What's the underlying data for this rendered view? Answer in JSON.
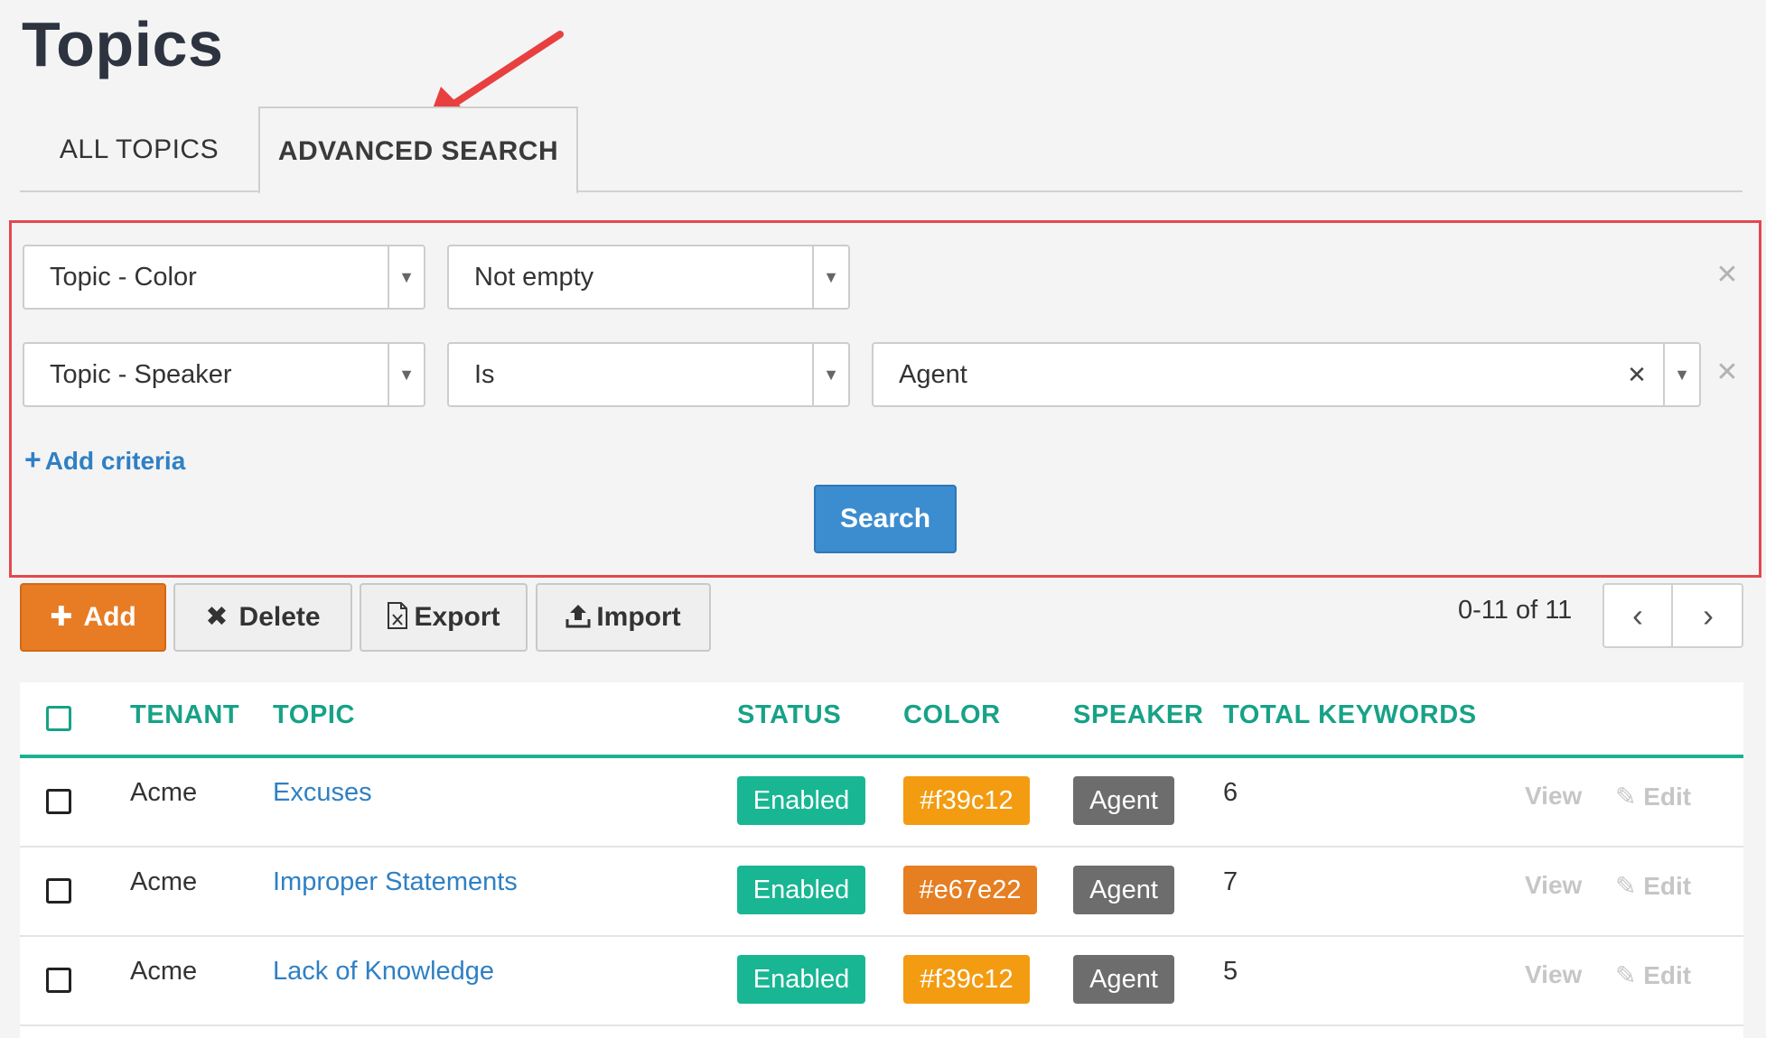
{
  "page": {
    "title": "Topics"
  },
  "tabs": [
    {
      "label": "ALL TOPICS",
      "active": false
    },
    {
      "label": "ADVANCED SEARCH",
      "active": true
    }
  ],
  "criteria": [
    {
      "field": "Topic - Color",
      "operator": "Not empty",
      "value": ""
    },
    {
      "field": "Topic - Speaker",
      "operator": "Is",
      "value": "Agent"
    }
  ],
  "actions": {
    "add_criteria": "Add criteria",
    "search": "Search",
    "add": "Add",
    "delete": "Delete",
    "export": "Export",
    "import": "Import"
  },
  "pagination": {
    "text": "0-11 of 11"
  },
  "table": {
    "columns": [
      "TENANT",
      "TOPIC",
      "STATUS",
      "COLOR",
      "SPEAKER",
      "TOTAL KEYWORDS"
    ],
    "row_actions": {
      "view": "View",
      "edit": "Edit"
    },
    "rows": [
      {
        "tenant": "Acme",
        "topic": "Excuses",
        "status": "Enabled",
        "color": "#f39c12",
        "speaker": "Agent",
        "total_keywords": "6"
      },
      {
        "tenant": "Acme",
        "topic": "Improper Statements",
        "status": "Enabled",
        "color": "#e67e22",
        "speaker": "Agent",
        "total_keywords": "7"
      },
      {
        "tenant": "Acme",
        "topic": "Lack of Knowledge",
        "status": "Enabled",
        "color": "#f39c12",
        "speaker": "Agent",
        "total_keywords": "5"
      }
    ]
  },
  "theme": {
    "accent": "#17a287",
    "link": "#2f80c4",
    "primary_button": "#3c8dcf",
    "add_button": "#e77c24",
    "highlight_border": "#e3484f",
    "status_enabled": "#19b693",
    "speaker_badge": "#6d6d6d"
  },
  "icons": {
    "add": "plus-icon",
    "delete": "close-icon",
    "export": "excel-file-icon",
    "import": "upload-icon",
    "prev": "chevron-left-icon",
    "next": "chevron-right-icon",
    "edit": "edit-icon",
    "dropdown": "caret-down-icon",
    "remove_row": "close-icon"
  }
}
